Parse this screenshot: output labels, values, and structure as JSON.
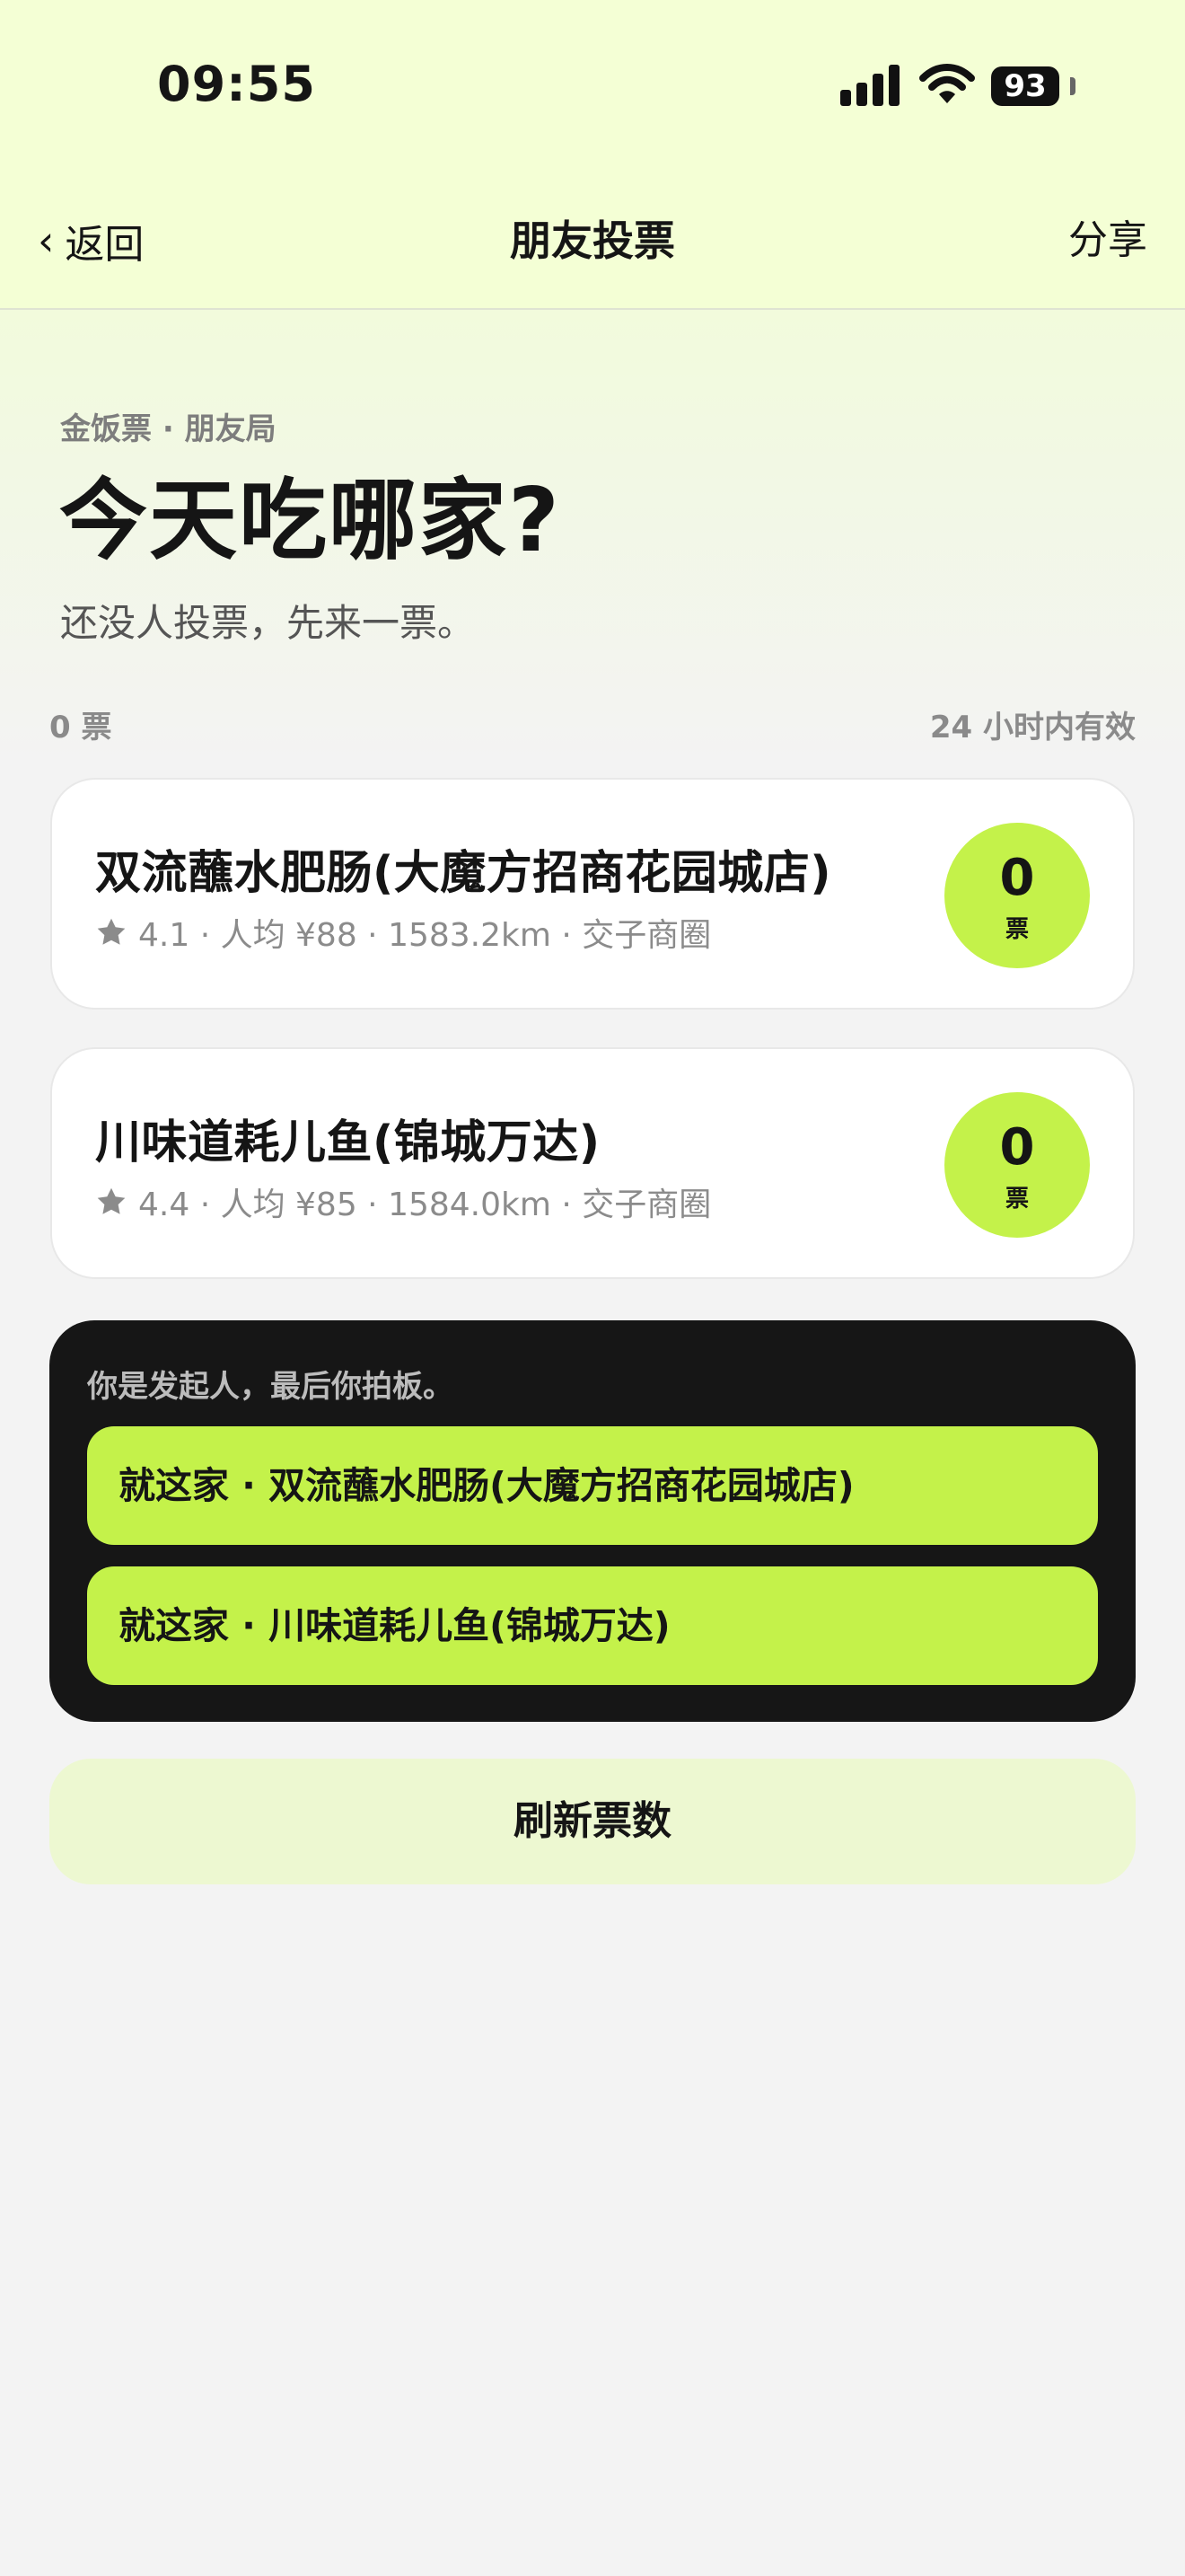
{
  "status_bar": {
    "time": "09:55",
    "battery": "93",
    "icons": [
      "cellular-signal-icon",
      "wifi-icon",
      "battery-icon"
    ]
  },
  "nav": {
    "back_label": "返回",
    "title": "朋友投票",
    "share_label": "分享"
  },
  "hero": {
    "eyebrow": "金饭票 · 朋友局",
    "title": "今天吃哪家?",
    "subtitle": "还没人投票，先来一票。"
  },
  "summary": {
    "votes": "0 票",
    "validity": "24 小时内有效"
  },
  "restaurants": [
    {
      "name": "双流蘸水肥肠(大魔方招商花园城店)",
      "meta": "4.1 · 人均 ¥88 · 1583.2km · 交子商圈",
      "votes": "0",
      "vote_unit": "票"
    },
    {
      "name": "川味道耗儿鱼(锦城万达)",
      "meta": "4.4 · 人均 ¥85 · 1584.0km · 交子商圈",
      "votes": "0",
      "vote_unit": "票"
    }
  ],
  "decision": {
    "note": "你是发起人，最后你拍板。",
    "choices": [
      "就这家 · 双流蘸水肥肠(大魔方招商花园城店)",
      "就这家 · 川味道耗儿鱼(锦城万达)"
    ]
  },
  "refresh_label": "刷新票数",
  "colors": {
    "header_bg": "#f4ffd5",
    "accent": "#c4f24a",
    "panel_dark": "#161616",
    "refresh_bg": "#edf8d1"
  }
}
